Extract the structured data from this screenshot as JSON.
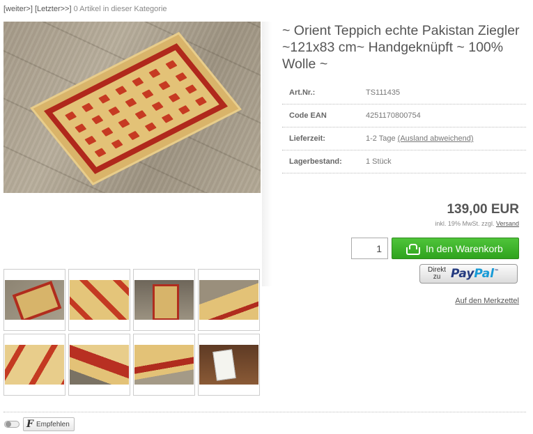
{
  "nav": {
    "next": "[weiter>]",
    "last": "[Letzter>>]",
    "category_info": "0 Artikel in dieser Kategorie"
  },
  "product": {
    "title": "~ Orient Teppich echte Pakistan Ziegler ~121x83 cm~ Handgeknüpft ~ 100% Wolle ~",
    "attributes": [
      {
        "label": "Art.Nr.:",
        "value": "TS111435"
      },
      {
        "label": "Code EAN",
        "value": "4251170800754"
      },
      {
        "label": "Lieferzeit:",
        "value": "1-2 Tage",
        "link": "(Ausland abweichend)"
      },
      {
        "label": "Lagerbestand:",
        "value": "1 Stück"
      }
    ],
    "price": "139,00 EUR",
    "tax_note": "inkl. 19% MwSt. zzgl.",
    "shipping_link": "Versand"
  },
  "purchase": {
    "quantity": "1",
    "cart_button": "In den Warenkorb",
    "paypal_direct_1": "Direkt",
    "paypal_direct_2": "zu",
    "paypal_logo_1": "Pay",
    "paypal_logo_2": "Pal",
    "paypal_tm": "™",
    "wishlist": "Auf den Merkzettel"
  },
  "social": {
    "recommend_icon": "F",
    "recommend_label": "Empfehlen"
  },
  "colors": {
    "cart_green": "#2fa31e",
    "paypal_dark": "#253b80",
    "paypal_light": "#179bd7"
  }
}
